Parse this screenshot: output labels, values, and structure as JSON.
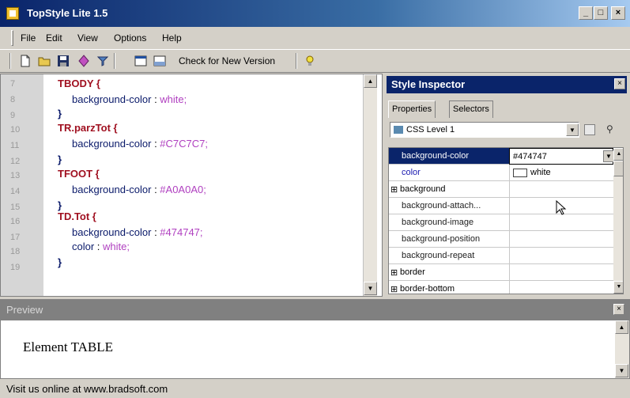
{
  "window": {
    "title": "TopStyle Lite 1.5",
    "min": "_",
    "max": "□",
    "close": "×"
  },
  "menu": {
    "file": "File",
    "edit": "Edit",
    "view": "View",
    "options": "Options",
    "help": "Help"
  },
  "toolbar": {
    "check_version": "Check for New Version"
  },
  "editor": {
    "line_numbers": [
      "7",
      "8",
      "9",
      "10",
      "11",
      "12",
      "13",
      "14",
      "15",
      "16",
      "17",
      "18",
      "19"
    ],
    "code": {
      "tbody_sel": "TBODY {",
      "bgcolor_prop": "background-color",
      "colon": " : ",
      "white_val": "white;",
      "close_brace": "}",
      "trparz_sel": "TR.parzTot {",
      "c7_val": "#C7C7C7;",
      "tfoot_sel": "TFOOT {",
      "a0_val": "#A0A0A0;",
      "tdtot_sel": "TD.Tot {",
      "val_474747": "#474747;",
      "color_prop": "color",
      "white_val2": "white;"
    }
  },
  "inspector": {
    "title": "Style Inspector",
    "close": "×",
    "tabs": {
      "properties": "Properties",
      "selectors": "Selectors"
    },
    "css_level": "CSS Level 1",
    "rows": {
      "bgcolor_name": "background-color",
      "bgcolor_value": "#474747",
      "color_name": "color",
      "color_value": "white",
      "background_name": "background",
      "bg_attach_name": "background-attach...",
      "bg_image_name": "background-image",
      "bg_position_name": "background-position",
      "bg_repeat_name": "background-repeat",
      "border_name": "border",
      "border_bottom_name": "border-bottom"
    },
    "expander": "⊞"
  },
  "preview": {
    "title": "Preview",
    "close": "×",
    "content": "Element TABLE"
  },
  "status": {
    "text": "Visit us online at www.bradsoft.com"
  },
  "colors": {
    "titlebar": "#0a246a",
    "selector": "#a01020",
    "value": "#b040c0",
    "property": "#0a1a6a"
  },
  "icons": [
    "app-icon",
    "new-file-icon",
    "open-folder-icon",
    "save-icon",
    "diamond-icon",
    "filter-icon",
    "preview-icon",
    "preview-pane-icon",
    "bulb-icon"
  ]
}
